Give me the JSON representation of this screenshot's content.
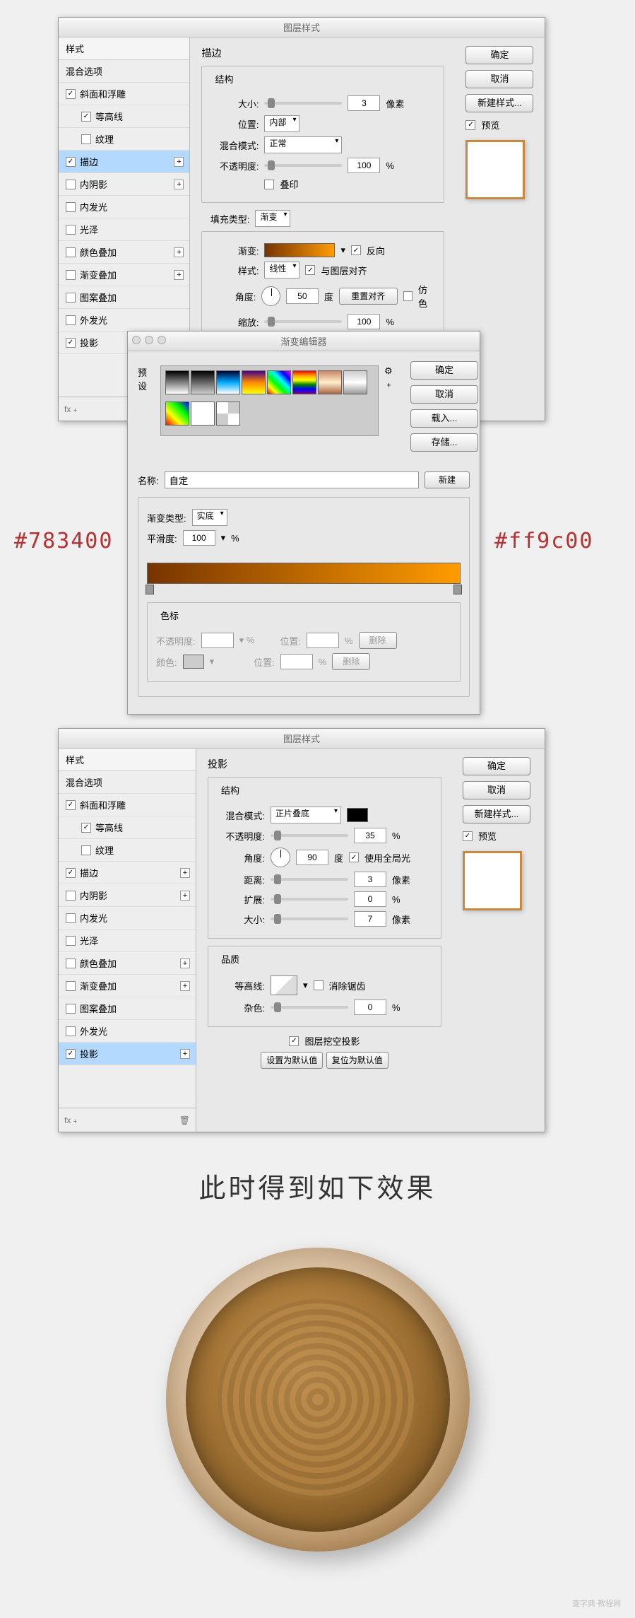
{
  "dialogs": {
    "layerStyle": {
      "title": "图层样式"
    },
    "gradientEditor": {
      "title": "渐变编辑器"
    }
  },
  "styleList": {
    "header": "样式",
    "blendOptions": "混合选项",
    "bevelEmboss": "斜面和浮雕",
    "contour": "等高线",
    "texture": "纹理",
    "stroke": "描边",
    "innerShadow": "内阴影",
    "innerGlow": "内发光",
    "satin": "光泽",
    "colorOverlay": "颜色叠加",
    "gradientOverlay": "渐变叠加",
    "patternOverlay": "图案叠加",
    "outerGlow": "外发光",
    "dropShadow": "投影"
  },
  "buttons": {
    "ok": "确定",
    "cancel": "取消",
    "newStyle": "新建样式...",
    "preview": "预览",
    "load": "载入...",
    "save": "存储...",
    "new": "新建",
    "resetDefault": "设置为默认值",
    "revertDefault": "复位为默认值",
    "resetAlign": "重置对齐",
    "delete": "删除"
  },
  "stroke": {
    "heading": "描边",
    "structure": "结构",
    "size": "大小:",
    "sizeVal": "3",
    "sizeUnit": "像素",
    "position": "位置:",
    "positionVal": "内部",
    "blendMode": "混合模式:",
    "blendModeVal": "正常",
    "opacity": "不透明度:",
    "opacityVal": "100",
    "percent": "%",
    "overprint": "叠印",
    "fillType": "填充类型:",
    "fillTypeVal": "渐变",
    "gradient": "渐变:",
    "reverse": "反向",
    "style": "样式:",
    "styleVal": "线性",
    "alignLayer": "与图层对齐",
    "angle": "角度:",
    "angleVal": "50",
    "degree": "度",
    "dither": "仿色",
    "scale": "缩放:",
    "scaleVal": "100"
  },
  "gradEditor": {
    "presets": "预设",
    "name": "名称:",
    "nameVal": "自定",
    "gradType": "渐变类型:",
    "gradTypeVal": "实底",
    "smoothness": "平滑度:",
    "smoothVal": "100",
    "stops": "色标",
    "stopOpacity": "不透明度:",
    "stopPosition": "位置:",
    "stopColor": "颜色:"
  },
  "hexLeft": "#783400",
  "hexRight": "#ff9c00",
  "dropShadow": {
    "heading": "投影",
    "structure": "结构",
    "blendMode": "混合模式:",
    "blendModeVal": "正片叠底",
    "opacity": "不透明度:",
    "opacityVal": "35",
    "angle": "角度:",
    "angleVal": "90",
    "degree": "度",
    "globalLight": "使用全局光",
    "distance": "距离:",
    "distanceVal": "3",
    "px": "像素",
    "spread": "扩展:",
    "spreadVal": "0",
    "percent": "%",
    "sizeLbl": "大小:",
    "sizeVal": "7",
    "quality": "品质",
    "contourLbl": "等高线:",
    "antialiased": "消除锯齿",
    "noiseLbl": "杂色:",
    "noiseVal": "0",
    "knockout": "图层挖空投影"
  },
  "resultHeading": "此时得到如下效果",
  "watermark": "查字典 教程网"
}
